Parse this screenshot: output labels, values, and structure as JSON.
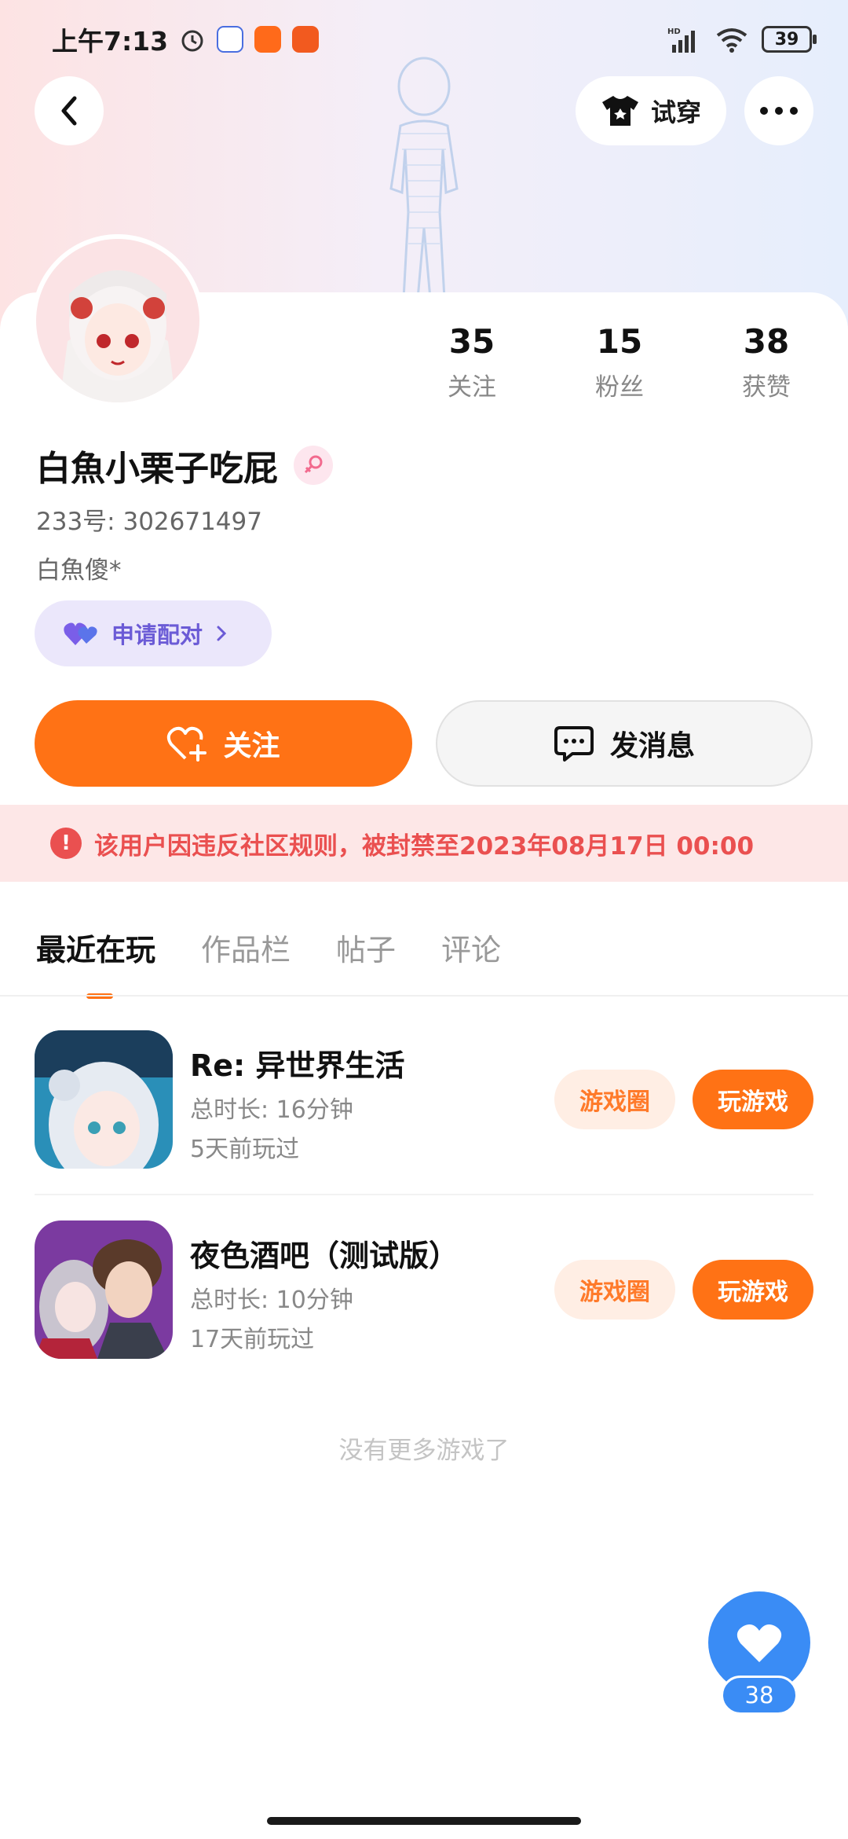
{
  "status_bar": {
    "time": "上午7:13",
    "battery": "39",
    "network_label": "HD"
  },
  "header": {
    "try_on_label": "试穿"
  },
  "profile": {
    "stats": [
      {
        "num": "35",
        "label": "关注"
      },
      {
        "num": "15",
        "label": "粉丝"
      },
      {
        "num": "38",
        "label": "获赞"
      }
    ],
    "username": "白魚小栗子吃屁",
    "id_text": "233号: 302671497",
    "bio": "白魚傻*",
    "pair_label": "申请配对"
  },
  "actions": {
    "follow_label": "关注",
    "message_label": "发消息"
  },
  "ban_notice": {
    "text": "该用户因违反社区规则，被封禁至2023年08月17日 00:00"
  },
  "tabs": [
    {
      "label": "最近在玩",
      "active": true
    },
    {
      "label": "作品栏",
      "active": false
    },
    {
      "label": "帖子",
      "active": false
    },
    {
      "label": "评论",
      "active": false
    }
  ],
  "games": [
    {
      "title": "Re: 异世界生活",
      "duration": "总时长: 16分钟",
      "last_played": "5天前玩过",
      "circle_label": "游戏圈",
      "play_label": "玩游戏"
    },
    {
      "title": "夜色酒吧（测试版）",
      "duration": "总时长: 10分钟",
      "last_played": "17天前玩过",
      "circle_label": "游戏圈",
      "play_label": "玩游戏"
    }
  ],
  "no_more_text": "没有更多游戏了",
  "like_fab": {
    "count": "38"
  },
  "colors": {
    "accent": "#ff7215",
    "ban": "#ea5050",
    "like": "#3a8cf5",
    "pair": "#6b5bd6"
  }
}
